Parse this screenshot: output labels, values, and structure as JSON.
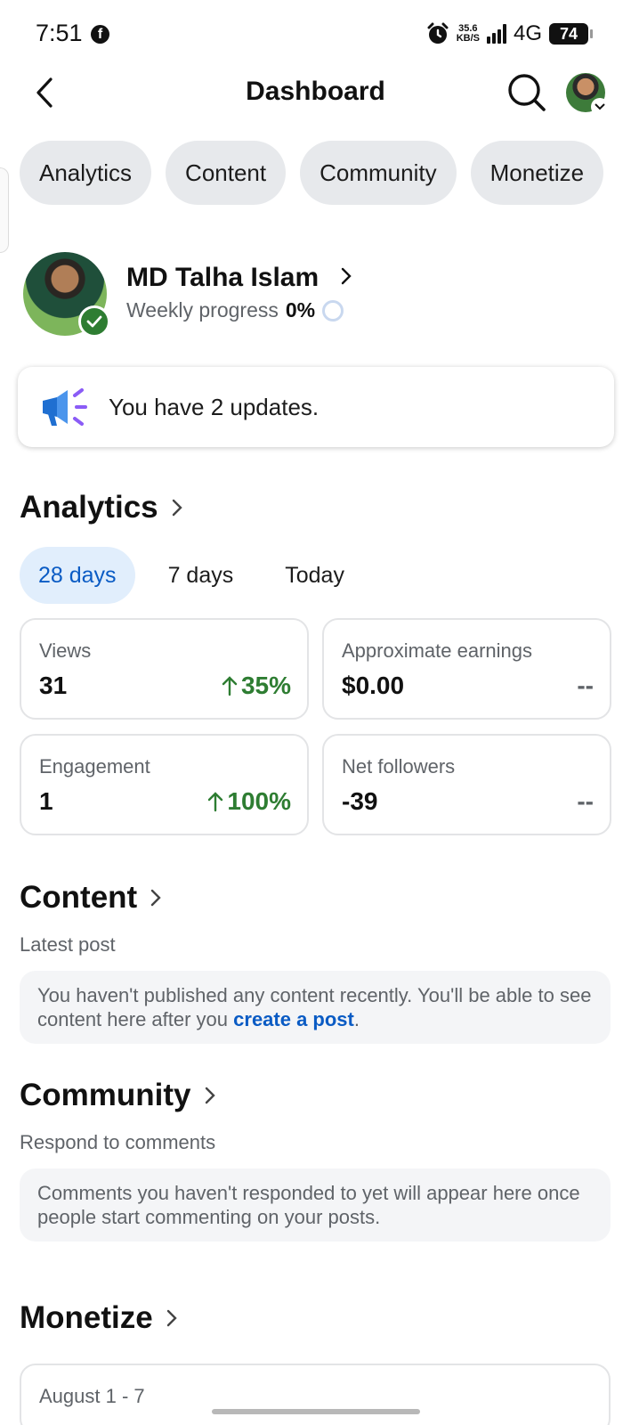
{
  "status_bar": {
    "time": "7:51",
    "app_icon": "facebook-icon",
    "net_speed_value": "35.6",
    "net_speed_unit": "KB/S",
    "network": "4G",
    "battery": "74"
  },
  "header": {
    "title": "Dashboard",
    "back_icon": "chevron-left-icon",
    "search_icon": "search-icon"
  },
  "tabs": [
    {
      "label": "Analytics"
    },
    {
      "label": "Content"
    },
    {
      "label": "Community"
    },
    {
      "label": "Monetize"
    }
  ],
  "profile": {
    "name": "MD Talha Islam",
    "progress_label": "Weekly progress",
    "progress_value": "0%"
  },
  "updates": {
    "text": "You have 2 updates.",
    "icon": "megaphone-icon"
  },
  "analytics": {
    "title": "Analytics",
    "ranges": [
      {
        "label": "28 days",
        "active": true
      },
      {
        "label": "7 days",
        "active": false
      },
      {
        "label": "Today",
        "active": false
      }
    ],
    "metrics": [
      {
        "label": "Views",
        "value": "31",
        "change": "35%",
        "trend": "up"
      },
      {
        "label": "Approximate earnings",
        "value": "$0.00",
        "change": "--",
        "trend": "none"
      },
      {
        "label": "Engagement",
        "value": "1",
        "change": "100%",
        "trend": "up"
      },
      {
        "label": "Net followers",
        "value": "-39",
        "change": "--",
        "trend": "none"
      }
    ]
  },
  "content": {
    "title": "Content",
    "subtitle": "Latest post",
    "message_before": "You haven't published any content recently. You'll be able to see content here after you ",
    "link": "create a post",
    "message_after": "."
  },
  "community": {
    "title": "Community",
    "subtitle": "Respond to comments",
    "message": "Comments you haven't responded to yet will appear here once people start commenting on your posts."
  },
  "monetize": {
    "title": "Monetize",
    "date_range": "August 1 - 7"
  },
  "colors": {
    "accent_blue": "#0a5bc4",
    "positive_green": "#2e7d32",
    "pill_gray": "#e7e9ec",
    "active_pill": "#e1eefc"
  }
}
